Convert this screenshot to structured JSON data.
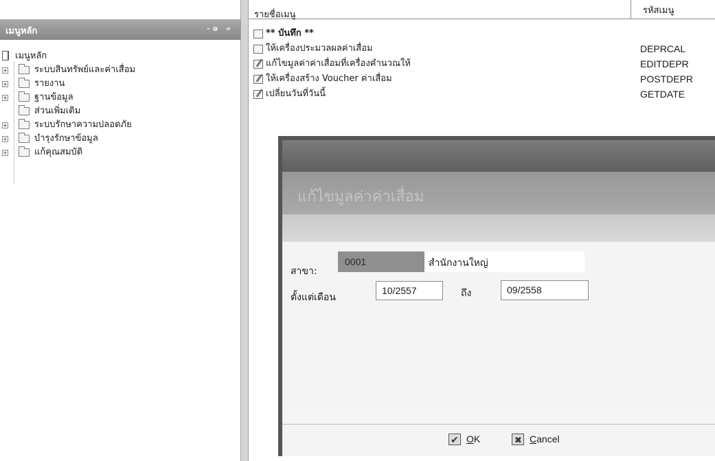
{
  "left_panel": {
    "header_title": "เมนูหลัก",
    "header_buttons": "-ə «",
    "tree": {
      "root": "เมนูหลัก",
      "items": [
        {
          "label": "ระบบสินทรัพย์และค่าเสื่อม",
          "expandable": true
        },
        {
          "label": "รายงาน",
          "expandable": true
        },
        {
          "label": "ฐานข้อมูล",
          "expandable": true
        },
        {
          "label": "ส่วนเพิ่มเติม",
          "expandable": false
        },
        {
          "label": "ระบบรักษาความปลอดภัย",
          "expandable": true
        },
        {
          "label": "บำรุงรักษาข้อมูล",
          "expandable": true
        },
        {
          "label": "แก้คุณสมบัติ",
          "expandable": true
        }
      ]
    }
  },
  "right_panel": {
    "columns": {
      "name": "รายชื่อเมนู",
      "code": "รหัสเมนู"
    },
    "rows": [
      {
        "label": "** บันทึก **",
        "code": ""
      },
      {
        "label": "ให้เครื่องประมวลผลค่าเสื่อม",
        "code": "DEPRCAL"
      },
      {
        "label": "แก้ไขมูลค่าค่าเสื่อมที่เครื่องคำนวณให้",
        "code": "EDITDEPR"
      },
      {
        "label": "ให้เครื่องสร้าง Voucher ค่าเสื่อม",
        "code": "POSTDEPR"
      },
      {
        "label": "เปลี่ยนวันที่วันนี้",
        "code": "GETDATE"
      }
    ]
  },
  "dialog": {
    "banner_title": "แก้ไขมูลค่าค่าเสื่อม",
    "branch_label": "สาขา:",
    "branch_code": "0001",
    "branch_name": "สำนักงานใหญ่",
    "from_label": "ตั้งแต่เดือน",
    "from_value": "10/2557",
    "to_label": "ถึง",
    "to_value": "09/2558",
    "ok_accel": "O",
    "ok_rest": "K",
    "cancel_accel": "C",
    "cancel_rest": "ancel"
  }
}
